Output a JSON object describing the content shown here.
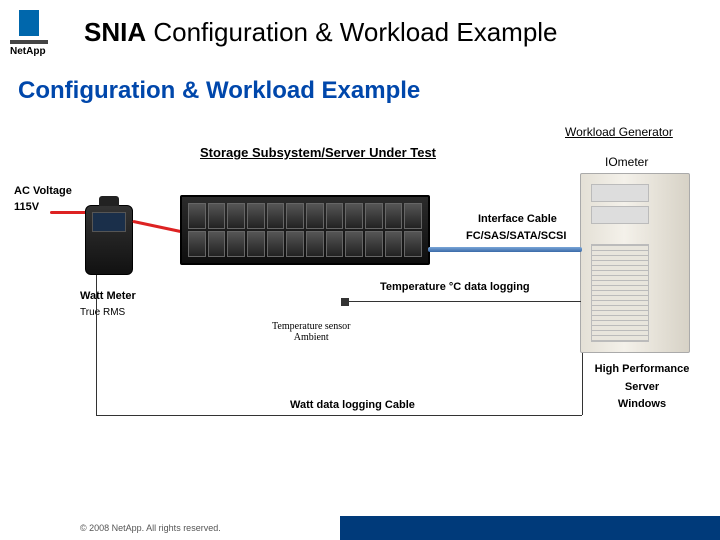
{
  "header": {
    "brand": "NetApp",
    "title_prefix": "SNIA",
    "title_rest": " Configuration & Workload Example"
  },
  "subtitle": "Configuration & Workload Example",
  "diagram": {
    "ac_voltage_label": "AC Voltage",
    "ac_voltage_value": "115V",
    "watt_meter_label": "Watt Meter",
    "watt_meter_type": "True RMS",
    "storage_label": "Storage Subsystem/Server Under Test",
    "workload_generator_label": "Workload Generator",
    "workload_tool": "IOmeter",
    "interface_cable_label": "Interface Cable",
    "interface_types": "FC/SAS/SATA/SCSI",
    "temperature_label": "Temperature °C data logging",
    "temp_sensor_line1": "Temperature sensor",
    "temp_sensor_line2": "Ambient",
    "watt_cable_label": "Watt data logging Cable",
    "tower_line1": "High Performance",
    "tower_line2": "Server",
    "tower_line3": "Windows"
  },
  "footer": {
    "copyright": "© 2008 NetApp. All rights reserved."
  }
}
